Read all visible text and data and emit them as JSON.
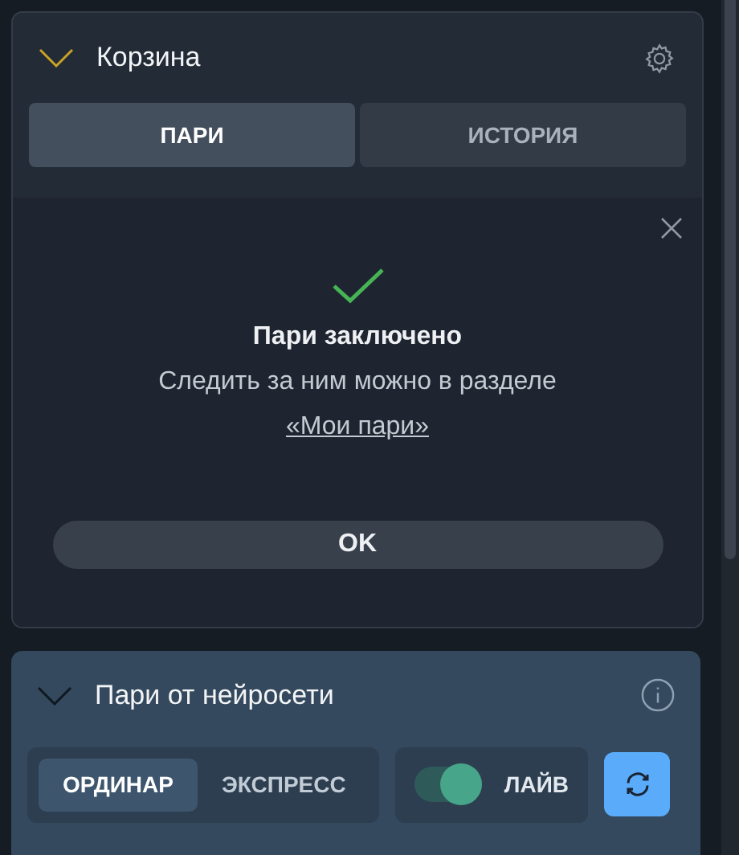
{
  "cart": {
    "title": "Корзина",
    "expanded": true,
    "tabs": [
      {
        "label": "ПАРИ",
        "selected": true
      },
      {
        "label": "ИСТОРИЯ",
        "selected": false
      }
    ],
    "dialog": {
      "title": "Пари заключено",
      "message": "Следить за ним можно в разделе",
      "link": "«Мои пари»",
      "button": "OK"
    }
  },
  "ai_bets": {
    "title": "Пари от нейросети",
    "expanded": true,
    "modes": [
      {
        "label": "ОРДИНАР",
        "selected": true
      },
      {
        "label": "ЭКСПРЕСС",
        "selected": false
      }
    ],
    "live": {
      "label": "ЛАЙВ",
      "on": true
    }
  }
}
